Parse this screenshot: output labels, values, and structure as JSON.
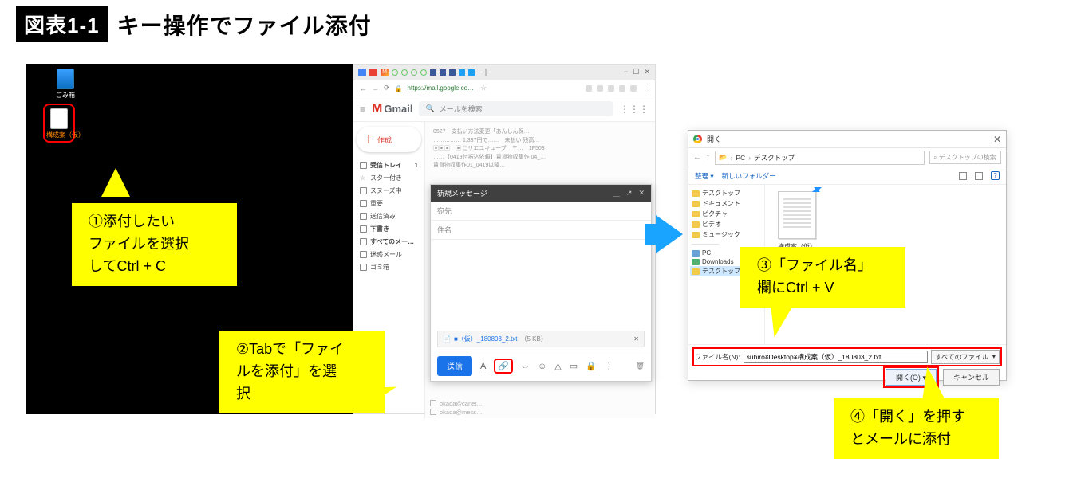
{
  "figure": {
    "badge": "図表1-1",
    "heading": "キー操作でファイル添付"
  },
  "desktop": {
    "trash_label": "ごみ箱",
    "file_label": "構成案（仮）"
  },
  "gmail": {
    "url": "https://mail.google.co…",
    "logo_m": "M",
    "logo_text": "Gmail",
    "search_placeholder": "メールを検索",
    "compose_label": "作成",
    "sidebar": [
      {
        "label": "受信トレイ",
        "badge": "1"
      },
      {
        "label": "スター付き"
      },
      {
        "label": "スヌーズ中"
      },
      {
        "label": "重要"
      },
      {
        "label": "送信済み"
      },
      {
        "label": "下書き"
      },
      {
        "label": "すべてのメー…"
      },
      {
        "label": "迷惑メール"
      },
      {
        "label": "ゴミ箱"
      }
    ],
    "preview_lines": [
      "0527　支払い方法変更「あんしん保…",
      "…………… 1,337円で……　未払い 残高…",
      "▣▣▣　▣ ❏リエユキューブ　〒…　1F503",
      "……【0419付振込依頼】賃貸物収集作 04_…",
      "賃貸物収集作01_0419以降…"
    ],
    "compose": {
      "title": "新規メッセージ",
      "to_label": "宛先",
      "subj_label": "件名",
      "attachment_name": "■（仮）_180803_2.txt",
      "attachment_size": "（5 KB）",
      "send_label": "送信"
    },
    "list_below": [
      "okada@canet…",
      "okada@mess…"
    ],
    "win_plus": "＋",
    "win_min": "−",
    "win_max": "☐",
    "win_close": "✕",
    "nav_back": "←",
    "nav_fwd": "→",
    "nav_reload": "⟳"
  },
  "callouts": {
    "c1": [
      "①添付したい",
      "ファイルを選択",
      "してCtrl + C"
    ],
    "c2": [
      "②Tabで「ファイ",
      "ルを添付」を選",
      "択"
    ],
    "c3": [
      "③「ファイル名」",
      "欄にCtrl + V"
    ],
    "c4": [
      "④「開く」を押す",
      "とメールに添付"
    ]
  },
  "dialog": {
    "title": "開く",
    "nav_back": "←",
    "nav_up": "↑",
    "path_pc": "PC",
    "path_sep": "›",
    "path_loc": "デスクトップ",
    "search_placeholder": "デスクトップの検索",
    "organize": "整理 ▾",
    "new_folder": "新しいフォルダー",
    "help": "?",
    "tree": [
      "デスクトップ",
      "ドキュメント",
      "ピクチャ",
      "ビデオ",
      "ミュージック"
    ],
    "tree_sep": "──────",
    "tree_pc": "PC",
    "tree_downloads": " Downloads",
    "tree_desktop": "デスクトップ",
    "file_thumb_label": "構成案（仮）",
    "fn_label": "ファイル名(N):",
    "fn_value": "suhiro¥Desktop¥構成案（仮）_180803_2.txt",
    "filter": "すべてのファイル",
    "open_btn": "開く(O)",
    "cancel_btn": "キャンセル",
    "close_x": "✕",
    "dropdown_glyph": "▾",
    "search_icon": "⌕"
  }
}
